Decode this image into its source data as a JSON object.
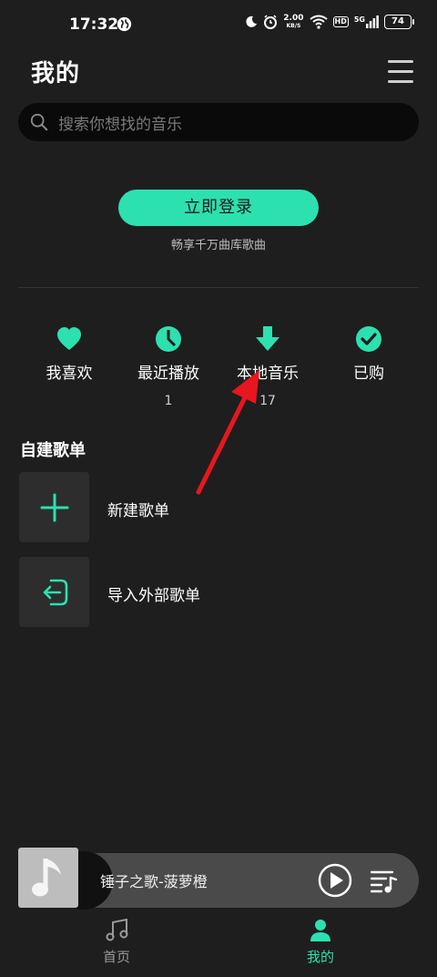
{
  "status_bar": {
    "time": "17:32",
    "speed_value": "2.00",
    "speed_unit": "KB/S",
    "hd": "HD",
    "network": "5G",
    "battery": "74"
  },
  "header": {
    "title": "我的",
    "menu_icon": "hamburger-menu-icon"
  },
  "search": {
    "placeholder": "搜索你想找的音乐"
  },
  "login": {
    "button_label": "立即登录",
    "subtitle": "畅享千万曲库歌曲"
  },
  "quick_entries": [
    {
      "label": "我喜欢",
      "count": "",
      "icon": "heart-icon"
    },
    {
      "label": "最近播放",
      "count": "1",
      "icon": "clock-icon"
    },
    {
      "label": "本地音乐",
      "count": "17",
      "icon": "download-icon"
    },
    {
      "label": "已购",
      "count": "",
      "icon": "check-circle-icon"
    }
  ],
  "playlists": {
    "section_title": "自建歌单",
    "items": [
      {
        "label": "新建歌单",
        "icon": "plus-icon"
      },
      {
        "label": "导入外部歌单",
        "icon": "import-icon"
      }
    ]
  },
  "player": {
    "song": "锤子之歌-菠萝橙"
  },
  "tabs": [
    {
      "label": "首页",
      "icon": "music-note-icon",
      "active": false
    },
    {
      "label": "我的",
      "icon": "person-icon",
      "active": true
    }
  ],
  "colors": {
    "accent": "#2de0b0",
    "background": "#1e1e1e",
    "annotation_arrow": "#e8161e"
  }
}
